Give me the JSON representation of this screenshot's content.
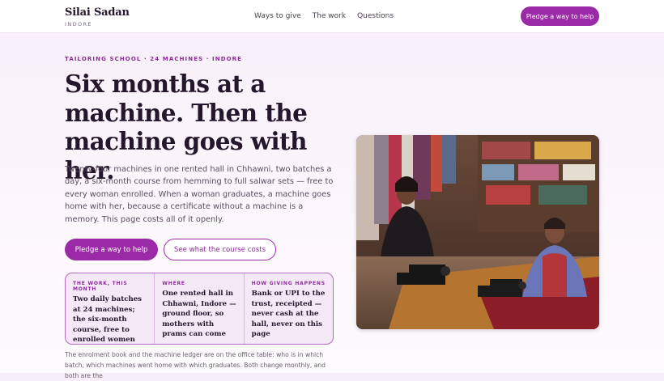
{
  "brand": {
    "name": "Silai Sadan",
    "city": "INDORE"
  },
  "nav": {
    "items": [
      "Ways to give",
      "The work",
      "Questions"
    ]
  },
  "header_cta": "Pledge a way to help",
  "hero": {
    "kicker": "TAILORING SCHOOL · 24 MACHINES · INDORE",
    "headline": "Six months at a machine. Then the machine goes with her.",
    "lede": "Twenty-four machines in one rented hall in Chhawni, two batches a day, a six-month course from hemming to full salwar sets — free to every woman enrolled. When a woman graduates, a machine goes home with her, because a certificate without a machine is a memory. This page costs all of it openly.",
    "cta_primary": "Pledge a way to help",
    "cta_secondary": "See what the course costs"
  },
  "facts": [
    {
      "label": "THE WORK, THIS MONTH",
      "text": "Two daily batches at 24 machines; the six-month course, free to enrolled women"
    },
    {
      "label": "WHERE",
      "text": "One rented hall in Chhawni, Indore — ground floor, so mothers with prams can come"
    },
    {
      "label": "HOW GIVING HAPPENS",
      "text": "Bank or UPI to the trust, receipted — never cash at the hall, never on this page"
    }
  ],
  "footnote": "The enrolment book and the machine ledger are on the office table: who is in which batch, which machines went home with which graduates. Both change monthly, and both are the",
  "photo": {
    "subject": "two-women-at-sewing-machines-photo"
  },
  "colors": {
    "accent": "#9b2aa6",
    "ink": "#24162c",
    "panel": "#f5e9f8"
  }
}
